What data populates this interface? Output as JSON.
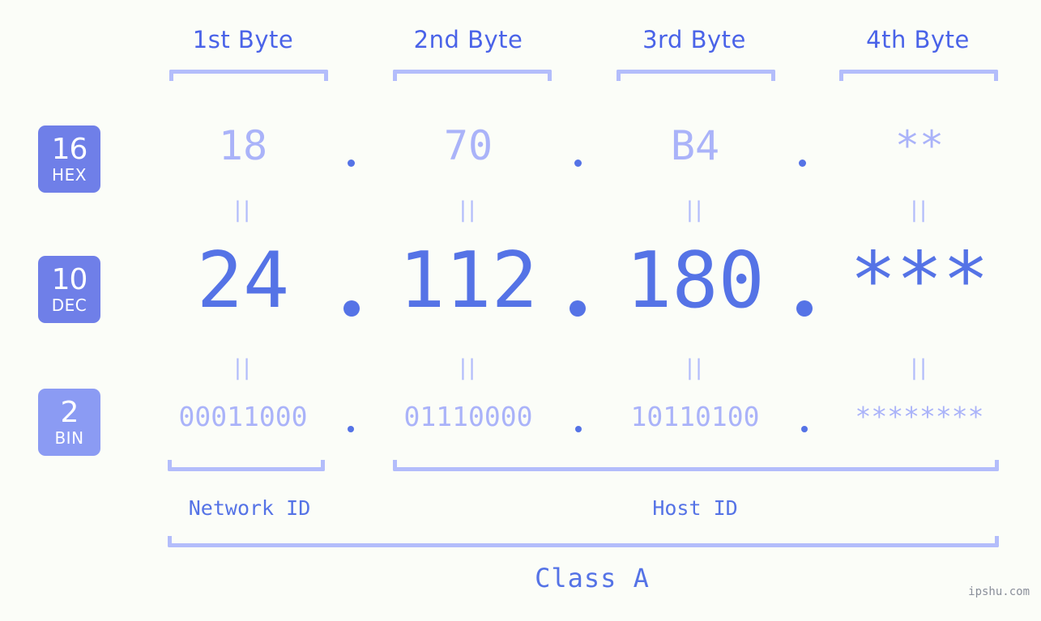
{
  "meta": {
    "watermark": "ipshu.com",
    "background_color": "#fbfdf8",
    "accent_strong": "#5573e6",
    "accent_light": "#aab3f9",
    "badge_color": "#6f7fe8",
    "badge_color_light": "#8b9bf3",
    "bracket_color": "#b3bdfb"
  },
  "headers": {
    "byte1": "1st Byte",
    "byte2": "2nd Byte",
    "byte3": "3rd Byte",
    "byte4": "4th Byte"
  },
  "rows": {
    "hex": {
      "badge_num": "16",
      "badge_sub": "HEX",
      "values": [
        "18",
        "70",
        "B4",
        "**"
      ],
      "separator": "."
    },
    "dec": {
      "badge_num": "10",
      "badge_sub": "DEC",
      "values": [
        "24",
        "112",
        "180",
        "***"
      ],
      "separator": "."
    },
    "bin": {
      "badge_num": "2",
      "badge_sub": "BIN",
      "values": [
        "00011000",
        "01110000",
        "10110100",
        "********"
      ],
      "separator": "."
    }
  },
  "equals_marks": {
    "glyph": "||",
    "count_per_row": 4
  },
  "footer": {
    "network_id": "Network ID",
    "host_id": "Host ID",
    "class": "Class A"
  }
}
